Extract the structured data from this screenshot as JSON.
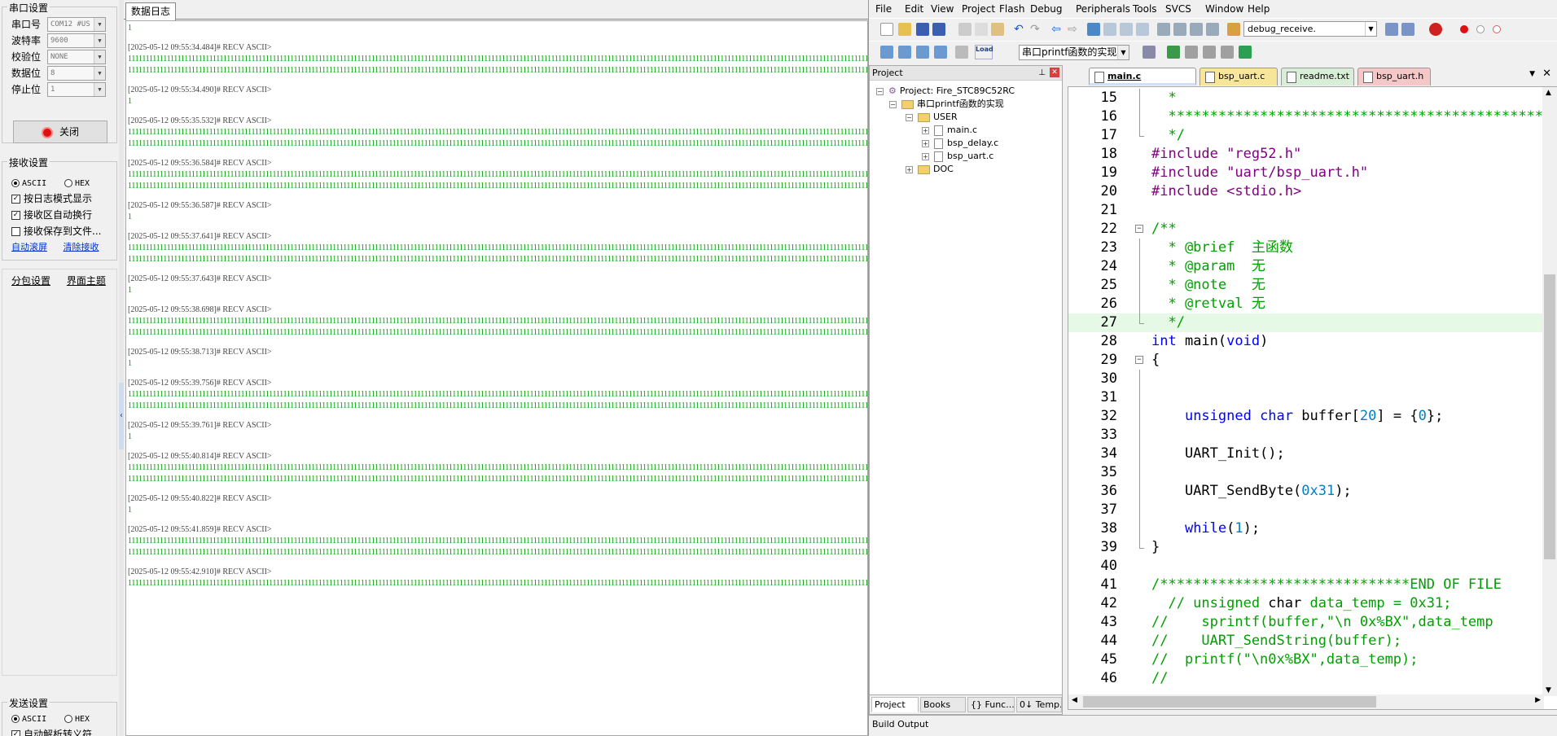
{
  "serial": {
    "section_title": "串口设置",
    "fields": [
      {
        "label": "串口号",
        "value": "COM12 #US"
      },
      {
        "label": "波特率",
        "value": "9600"
      },
      {
        "label": "校验位",
        "value": "NONE"
      },
      {
        "label": "数据位",
        "value": "8"
      },
      {
        "label": "停止位",
        "value": "1"
      }
    ],
    "close_button": "关闭"
  },
  "receive": {
    "section_title": "接收设置",
    "radio_ascii": "ASCII",
    "radio_hex": "HEX",
    "check_log_mode": "按日志模式显示",
    "check_autowrap": "接收区自动换行",
    "check_save_file": "接收保存到文件...",
    "link_autoscroll": "自动滚屏",
    "link_clear": "清除接收"
  },
  "packet": {
    "tab_packet": "分包设置",
    "tab_theme": "界面主题"
  },
  "send": {
    "section_title": "发送设置",
    "radio_ascii": "ASCII",
    "radio_hex": "HEX",
    "check_escape": "自动解析转义符"
  },
  "log": {
    "tab_label": "数据日志",
    "entries": [
      {
        "header": "",
        "lines": [
          "1"
        ]
      },
      {
        "header": "[2025-05-12 09:55:34.484]# RECV ASCII>",
        "lines": [
          "11111111111111111111111111111111111111111111111111111111111111111111111111111111111111111111111111111111111111111111111111111111111111111111111111111111111111111111111111111111111111111111111111111111111111111111111111111111111111111111111111",
          "11111111111111111111111111111111111111111111111111111111111111111111111111111111111111111111111111111111111111111111111111111111111111111111111111111111111111111111111111111111111111111111111111111111111111111111111111111111111111111111111111"
        ]
      },
      {
        "header": "[2025-05-12 09:55:34.490]# RECV ASCII>",
        "lines": [
          "1"
        ]
      },
      {
        "header": "[2025-05-12 09:55:35.532]# RECV ASCII>",
        "lines": [
          "11111111111111111111111111111111111111111111111111111111111111111111111111111111111111111111111111111111111111111111111111111111111111111111111111111111111111111111111111111111111111111111111111111111111111111111111111111111111111111111111111",
          "11111111111111111111111111111111111111111111111111111111111111111111111111111111111111111111111111111111111111111111111111111111111111111111111111111111111111111111111111111111111111111111111111111111111111111111111111111111111111111111111111"
        ]
      },
      {
        "header": "[2025-05-12 09:55:36.584]# RECV ASCII>",
        "lines": [
          "11111111111111111111111111111111111111111111111111111111111111111111111111111111111111111111111111111111111111111111111111111111111111111111111111111111111111111111111111111111111111111111111111111111111111111111111111111111111111111111111111",
          "11111111111111111111111111111111111111111111111111111111111111111111111111111111111111111111111111111111111111111111111111111111111111111111111111111111111111111111111111111111111111111111111111111111111111111111111111111111111111111111111111"
        ]
      },
      {
        "header": "[2025-05-12 09:55:36.587]# RECV ASCII>",
        "lines": [
          "1"
        ]
      },
      {
        "header": "[2025-05-12 09:55:37.641]# RECV ASCII>",
        "lines": [
          "11111111111111111111111111111111111111111111111111111111111111111111111111111111111111111111111111111111111111111111111111111111111111111111111111111111111111111111111111111111111111111111111111111111111111111111111111111111111111111111111111",
          "11111111111111111111111111111111111111111111111111111111111111111111111111111111111111111111111111111111111111111111111111111111111111111111111111111111111111111111111111111111111111111111111111111111111111111111111111111111111111111111111111"
        ]
      },
      {
        "header": "[2025-05-12 09:55:37.643]# RECV ASCII>",
        "lines": [
          "1"
        ]
      },
      {
        "header": "[2025-05-12 09:55:38.698]# RECV ASCII>",
        "lines": [
          "11111111111111111111111111111111111111111111111111111111111111111111111111111111111111111111111111111111111111111111111111111111111111111111111111111111111111111111111111111111111111111111111111111111111111111111111111111111111111111111111111",
          "11111111111111111111111111111111111111111111111111111111111111111111111111111111111111111111111111111111111111111111111111111111111111111111111111111111111111111111111111111111111111111111111111111111111111111111111111111111111111111111111111"
        ]
      },
      {
        "header": "[2025-05-12 09:55:38.713]# RECV ASCII>",
        "lines": [
          "1"
        ]
      },
      {
        "header": "[2025-05-12 09:55:39.756]# RECV ASCII>",
        "lines": [
          "11111111111111111111111111111111111111111111111111111111111111111111111111111111111111111111111111111111111111111111111111111111111111111111111111111111111111111111111111111111111111111111111111111111111111111111111111111111111111111111111111",
          "11111111111111111111111111111111111111111111111111111111111111111111111111111111111111111111111111111111111111111111111111111111111111111111111111111111111111111111111111111111111111111111111111111111111111111111111111111111111111111111111111"
        ]
      },
      {
        "header": "[2025-05-12 09:55:39.761]# RECV ASCII>",
        "lines": [
          "1"
        ]
      },
      {
        "header": "[2025-05-12 09:55:40.814]# RECV ASCII>",
        "lines": [
          "11111111111111111111111111111111111111111111111111111111111111111111111111111111111111111111111111111111111111111111111111111111111111111111111111111111111111111111111111111111111111111111111111111111111111111111111111111111111111111111111111",
          "11111111111111111111111111111111111111111111111111111111111111111111111111111111111111111111111111111111111111111111111111111111111111111111111111111111111111111111111111111111111111111111111111111111111111111111111111111111111111111111111111"
        ]
      },
      {
        "header": "[2025-05-12 09:55:40.822]# RECV ASCII>",
        "lines": [
          "1"
        ]
      },
      {
        "header": "[2025-05-12 09:55:41.859]# RECV ASCII>",
        "lines": [
          "11111111111111111111111111111111111111111111111111111111111111111111111111111111111111111111111111111111111111111111111111111111111111111111111111111111111111111111111111111111111111111111111111111111111111111111111111111111111111111111111111",
          "11111111111111111111111111111111111111111111111111111111111111111111111111111111111111111111111111111111111111111111111111111111111111111111111111111111111111111111111111111111111111111111111111111111111111111111111111111111111111111111111111"
        ]
      },
      {
        "header": "[2025-05-12 09:55:42.910]# RECV ASCII>",
        "lines": [
          "11111111111111111111111111111111111111111111111111111111111111111111111111111111111111111111111111111111111111111111111111111111111111111111111111111111111111111111111111111111111111111111111111111111111111111111111111111111111111111111111111"
        ]
      }
    ]
  },
  "keil": {
    "menu": [
      "File",
      "Edit",
      "View",
      "Project",
      "Flash",
      "Debug",
      "Peripherals",
      "Tools",
      "SVCS",
      "Window",
      "Help"
    ],
    "toolbar_target": "debug_receive.",
    "toolbar_project_combo": "串口printf函数的实现",
    "toolbar_load": "Load",
    "project_pane_title": "Project",
    "tree": [
      {
        "label": "Project: Fire_STC89C52RC",
        "level": 0,
        "kind": "project"
      },
      {
        "label": "串口printf函数的实现",
        "level": 1,
        "kind": "target"
      },
      {
        "label": "USER",
        "level": 2,
        "kind": "folder"
      },
      {
        "label": "main.c",
        "level": 3,
        "kind": "file"
      },
      {
        "label": "bsp_delay.c",
        "level": 3,
        "kind": "file"
      },
      {
        "label": "bsp_uart.c",
        "level": 3,
        "kind": "file"
      },
      {
        "label": "DOC",
        "level": 2,
        "kind": "folder"
      }
    ],
    "project_tabs": [
      "Project",
      "Books",
      "{} Func...",
      "0↓ Temp..."
    ],
    "editor_tabs": [
      {
        "label": "main.c",
        "color": "#cfe0f7",
        "active": true
      },
      {
        "label": "bsp_uart.c",
        "color": "#f7e59a",
        "active": false
      },
      {
        "label": "readme.txt",
        "color": "#d9eed6",
        "active": false
      },
      {
        "label": "bsp_uart.h",
        "color": "#f5c7c7",
        "active": false
      }
    ],
    "build_output": "Build Output",
    "code": [
      {
        "n": "15",
        "fold": "line",
        "hl": false,
        "parts": [
          [
            "c-cm",
            "  *"
          ]
        ]
      },
      {
        "n": "16",
        "fold": "line",
        "hl": false,
        "parts": [
          [
            "c-cm",
            "  ************************************************"
          ]
        ]
      },
      {
        "n": "17",
        "fold": "end",
        "hl": false,
        "parts": [
          [
            "c-cm",
            "  */"
          ]
        ]
      },
      {
        "n": "18",
        "fold": "",
        "hl": false,
        "parts": [
          [
            "c-pp",
            "#include "
          ],
          [
            "c-st",
            "\"reg52.h\""
          ]
        ]
      },
      {
        "n": "19",
        "fold": "",
        "hl": false,
        "parts": [
          [
            "c-pp",
            "#include "
          ],
          [
            "c-st",
            "\"uart/bsp_uart.h\""
          ]
        ]
      },
      {
        "n": "20",
        "fold": "",
        "hl": false,
        "parts": [
          [
            "c-pp",
            "#include "
          ],
          [
            "c-st",
            "<stdio.h>"
          ]
        ]
      },
      {
        "n": "21",
        "fold": "",
        "hl": false,
        "parts": [
          [
            "c-tx",
            ""
          ]
        ]
      },
      {
        "n": "22",
        "fold": "open",
        "hl": false,
        "parts": [
          [
            "c-cm",
            "/**"
          ]
        ]
      },
      {
        "n": "23",
        "fold": "line",
        "hl": false,
        "parts": [
          [
            "c-cm",
            "  * @brief  主函数"
          ]
        ]
      },
      {
        "n": "24",
        "fold": "line",
        "hl": false,
        "parts": [
          [
            "c-cm",
            "  * @param  无"
          ]
        ]
      },
      {
        "n": "25",
        "fold": "line",
        "hl": false,
        "parts": [
          [
            "c-cm",
            "  * @note   无"
          ]
        ]
      },
      {
        "n": "26",
        "fold": "line",
        "hl": false,
        "parts": [
          [
            "c-cm",
            "  * @retval 无"
          ]
        ]
      },
      {
        "n": "27",
        "fold": "end",
        "hl": true,
        "parts": [
          [
            "c-cm",
            "  */"
          ]
        ]
      },
      {
        "n": "28",
        "fold": "",
        "hl": false,
        "parts": [
          [
            "c-kw",
            "int"
          ],
          [
            "c-tx",
            " main("
          ],
          [
            "c-kw",
            "void"
          ],
          [
            "c-tx",
            ")"
          ]
        ]
      },
      {
        "n": "29",
        "fold": "open",
        "hl": false,
        "parts": [
          [
            "c-tx",
            "{"
          ]
        ]
      },
      {
        "n": "30",
        "fold": "line",
        "hl": false,
        "parts": [
          [
            "c-tx",
            ""
          ]
        ]
      },
      {
        "n": "31",
        "fold": "line",
        "hl": false,
        "parts": [
          [
            "c-tx",
            ""
          ]
        ]
      },
      {
        "n": "32",
        "fold": "line",
        "hl": false,
        "parts": [
          [
            "c-tx",
            "    "
          ],
          [
            "c-kw",
            "unsigned char"
          ],
          [
            "c-tx",
            " buffer["
          ],
          [
            "c-nm",
            "20"
          ],
          [
            "c-tx",
            "] = {"
          ],
          [
            "c-nm",
            "0"
          ],
          [
            "c-tx",
            "};"
          ]
        ]
      },
      {
        "n": "33",
        "fold": "line",
        "hl": false,
        "parts": [
          [
            "c-tx",
            ""
          ]
        ]
      },
      {
        "n": "34",
        "fold": "line",
        "hl": false,
        "parts": [
          [
            "c-tx",
            "    UART_Init();"
          ]
        ]
      },
      {
        "n": "35",
        "fold": "line",
        "hl": false,
        "parts": [
          [
            "c-tx",
            ""
          ]
        ]
      },
      {
        "n": "36",
        "fold": "line",
        "hl": false,
        "parts": [
          [
            "c-tx",
            "    UART_SendByte("
          ],
          [
            "c-nm",
            "0x31"
          ],
          [
            "c-tx",
            ");"
          ]
        ]
      },
      {
        "n": "37",
        "fold": "line",
        "hl": false,
        "parts": [
          [
            "c-tx",
            ""
          ]
        ]
      },
      {
        "n": "38",
        "fold": "line",
        "hl": false,
        "parts": [
          [
            "c-tx",
            "    "
          ],
          [
            "c-kw",
            "while"
          ],
          [
            "c-tx",
            "("
          ],
          [
            "c-nm",
            "1"
          ],
          [
            "c-tx",
            ");"
          ]
        ]
      },
      {
        "n": "39",
        "fold": "end",
        "hl": false,
        "parts": [
          [
            "c-tx",
            "}"
          ]
        ]
      },
      {
        "n": "40",
        "fold": "",
        "hl": false,
        "parts": [
          [
            "c-tx",
            ""
          ]
        ]
      },
      {
        "n": "41",
        "fold": "",
        "hl": false,
        "parts": [
          [
            "c-cm",
            "/******************************END OF FILE"
          ]
        ]
      },
      {
        "n": "42",
        "fold": "",
        "hl": false,
        "parts": [
          [
            "c-cm",
            "  // unsigned "
          ],
          [
            "c-tx",
            "char"
          ],
          [
            "c-cm",
            " data_temp = 0x31;"
          ]
        ]
      },
      {
        "n": "43",
        "fold": "",
        "hl": false,
        "parts": [
          [
            "c-cm",
            "//    sprintf(buffer,\"\\n 0x%BX\",data_temp"
          ]
        ]
      },
      {
        "n": "44",
        "fold": "",
        "hl": false,
        "parts": [
          [
            "c-cm",
            "//    UART_SendString(buffer);"
          ]
        ]
      },
      {
        "n": "45",
        "fold": "",
        "hl": false,
        "parts": [
          [
            "c-cm",
            "//  printf(\"\\n0x%BX\",data_temp);"
          ]
        ]
      },
      {
        "n": "46",
        "fold": "",
        "hl": false,
        "parts": [
          [
            "c-cm",
            "//"
          ]
        ]
      }
    ]
  }
}
